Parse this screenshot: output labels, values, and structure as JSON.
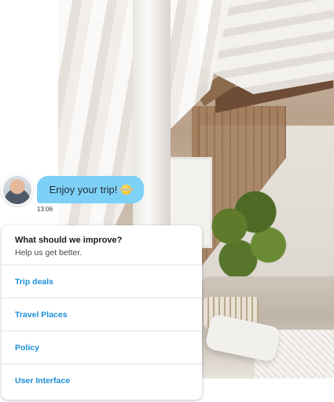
{
  "chat": {
    "message": "Enjoy your trip!",
    "time": "13:06"
  },
  "survey": {
    "question": "What should we improve?",
    "subtitle": "Help us get better.",
    "options": [
      {
        "label": "Trip deals"
      },
      {
        "label": "Travel Places"
      },
      {
        "label": "Policy"
      },
      {
        "label": "User Interface"
      }
    ]
  },
  "colors": {
    "bubble": "#7ed1f6",
    "link": "#1a8fd6"
  },
  "icons": {
    "avatar": "user-avatar",
    "emoji": "sun-with-cloud-emoji"
  }
}
